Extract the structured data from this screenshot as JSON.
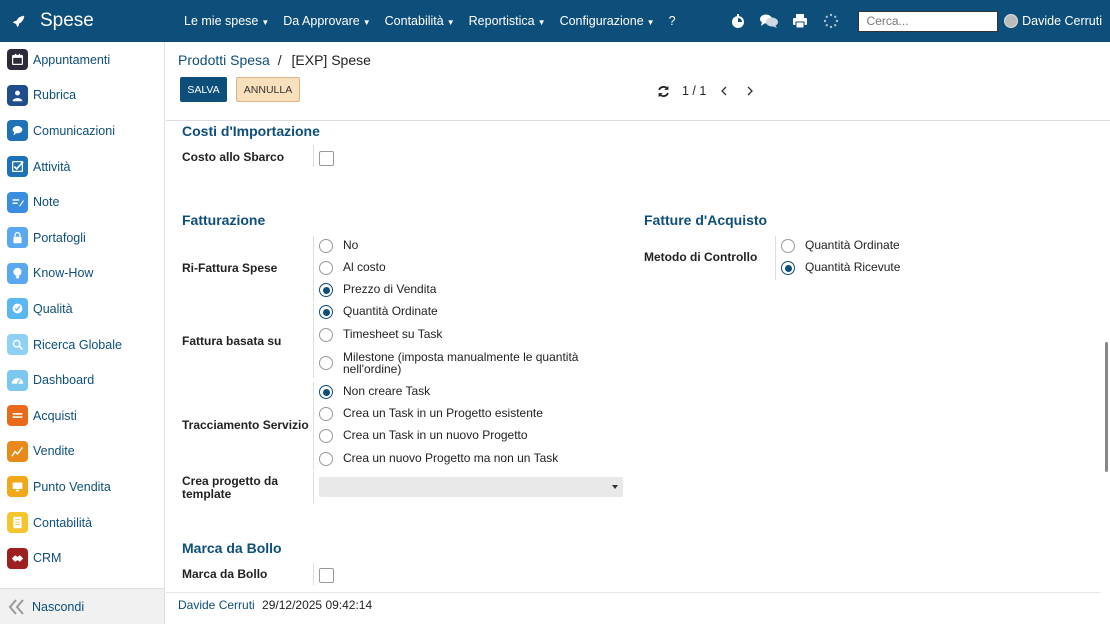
{
  "app": {
    "title": "Spese"
  },
  "topnav": {
    "menus": [
      {
        "label": "Le mie spese",
        "caret": true
      },
      {
        "label": "Da Approvare",
        "caret": true
      },
      {
        "label": "Contabilità",
        "caret": true
      },
      {
        "label": "Reportistica",
        "caret": true
      },
      {
        "label": "Configurazione",
        "caret": true
      },
      {
        "label": "?",
        "caret": false
      }
    ],
    "search_placeholder": "Cerca...",
    "user_name": "Davide Cerruti"
  },
  "sidebar": {
    "items": [
      {
        "label": "Appuntamenti",
        "icon": "calendar-icon",
        "color": "#2b2b3a"
      },
      {
        "label": "Rubrica",
        "icon": "contacts-icon",
        "color": "#1f4e8c"
      },
      {
        "label": "Comunicazioni",
        "icon": "chat-icon",
        "color": "#1f72b8"
      },
      {
        "label": "Attività",
        "icon": "check-icon",
        "color": "#1f72b8"
      },
      {
        "label": "Note",
        "icon": "note-icon",
        "color": "#3b8de0"
      },
      {
        "label": "Portafogli",
        "icon": "lock-icon",
        "color": "#5aa8f0"
      },
      {
        "label": "Know-How",
        "icon": "bulb-icon",
        "color": "#5aa8f0"
      },
      {
        "label": "Qualità",
        "icon": "quality-icon",
        "color": "#5ab8f0"
      },
      {
        "label": "Ricerca Globale",
        "icon": "search-icon",
        "color": "#8fd0f5"
      },
      {
        "label": "Dashboard",
        "icon": "dashboard-icon",
        "color": "#7cc7ef"
      },
      {
        "label": "Acquisti",
        "icon": "cart-icon",
        "color": "#e86a1a"
      },
      {
        "label": "Vendite",
        "icon": "chart-icon",
        "color": "#e8891a"
      },
      {
        "label": "Punto Vendita",
        "icon": "pos-icon",
        "color": "#f0a81a"
      },
      {
        "label": "Contabilità",
        "icon": "ledger-icon",
        "color": "#f5c530"
      },
      {
        "label": "CRM",
        "icon": "handshake-icon",
        "color": "#9c2020"
      }
    ],
    "hide_label": "Nascondi"
  },
  "breadcrumb": {
    "parent": "Prodotti Spesa",
    "separator": "/",
    "current": "[EXP] Spese"
  },
  "buttons": {
    "save": "SALVA",
    "cancel": "ANNULLA"
  },
  "pager": {
    "value": "1 / 1"
  },
  "form": {
    "costi": {
      "title": "Costi d'Importazione",
      "field_label": "Costo allo Sbarco",
      "checked": false
    },
    "fatturazione": {
      "title": "Fatturazione",
      "rifattura": {
        "label": "Ri-Fattura Spese",
        "options": [
          {
            "label": "No",
            "checked": false
          },
          {
            "label": "Al costo",
            "checked": false
          },
          {
            "label": "Prezzo di Vendita",
            "checked": true
          }
        ]
      },
      "basata": {
        "label": "Fattura basata su",
        "options": [
          {
            "label": "Quantità Ordinate",
            "checked": true
          },
          {
            "label": "Timesheet su Task",
            "checked": false
          },
          {
            "label": "Milestone (imposta manualmente le quantità",
            "label2": "nell'ordine)",
            "checked": false
          }
        ]
      },
      "tracciamento": {
        "label": "Tracciamento Servizio",
        "options": [
          {
            "label": "Non creare Task",
            "checked": true
          },
          {
            "label": "Crea un Task in un Progetto esistente",
            "checked": false
          },
          {
            "label": "Crea un Task in un nuovo Progetto",
            "checked": false
          },
          {
            "label": "Crea un nuovo Progetto ma non un Task",
            "checked": false
          }
        ]
      },
      "template": {
        "label_line1": "Crea progetto da",
        "label_line2": "template",
        "value": ""
      }
    },
    "fatture_acquisto": {
      "title": "Fatture d'Acquisto",
      "metodo": {
        "label": "Metodo di Controllo",
        "options": [
          {
            "label": "Quantità Ordinate",
            "checked": false
          },
          {
            "label": "Quantità Ricevute",
            "checked": true
          }
        ]
      }
    },
    "bollo": {
      "title": "Marca da Bollo",
      "field_label": "Marca da Bollo",
      "checked": false
    }
  },
  "footer": {
    "user": "Davide Cerruti",
    "timestamp": "29/12/2025 09:42:14"
  }
}
